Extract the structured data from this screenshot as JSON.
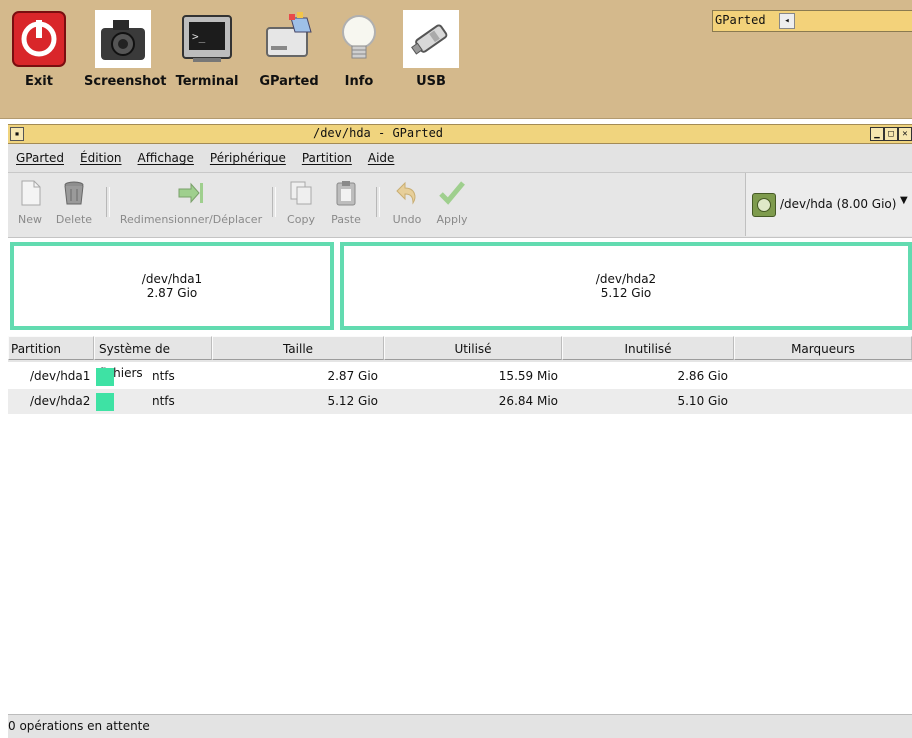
{
  "launcher": {
    "items": [
      {
        "label": "Exit",
        "icon": "power-icon"
      },
      {
        "label": "Screenshot",
        "icon": "camera-icon"
      },
      {
        "label": "Terminal",
        "icon": "terminal-icon"
      },
      {
        "label": "GParted",
        "icon": "gparted-icon"
      },
      {
        "label": "Info",
        "icon": "lightbulb-icon"
      },
      {
        "label": "USB",
        "icon": "usb-drive-icon"
      }
    ],
    "task_label": "GParted"
  },
  "window": {
    "title": "/dev/hda - GParted"
  },
  "menubar": {
    "items": [
      "GParted",
      "Édition",
      "Affichage",
      "Périphérique",
      "Partition",
      "Aide"
    ]
  },
  "toolbar": {
    "new": "New",
    "delete": "Delete",
    "resize": "Redimensionner/Déplacer",
    "copy": "Copy",
    "paste": "Paste",
    "undo": "Undo",
    "apply": "Apply",
    "device": "/dev/hda  (8.00 Gio)"
  },
  "partition_map": [
    {
      "name": "/dev/hda1",
      "size": "2.87 Gio"
    },
    {
      "name": "/dev/hda2",
      "size": "5.12 Gio"
    }
  ],
  "table": {
    "headers": [
      "Partition",
      "Système de fichiers",
      "Taille",
      "Utilisé",
      "Inutilisé",
      "Marqueurs"
    ],
    "rows": [
      {
        "partition": "/dev/hda1",
        "fs": "ntfs",
        "size": "2.87 Gio",
        "used": "15.59 Mio",
        "unused": "2.86 Gio",
        "flags": ""
      },
      {
        "partition": "/dev/hda2",
        "fs": "ntfs",
        "size": "5.12 Gio",
        "used": "26.84 Mio",
        "unused": "5.10 Gio",
        "flags": ""
      }
    ]
  },
  "status": {
    "text": "0 opérations en attente"
  },
  "colors": {
    "panel": "#d4b98c",
    "titlebar": "#f0d47e",
    "ntfs": "#3ee2a4",
    "partition_border": "#62dbb0"
  }
}
